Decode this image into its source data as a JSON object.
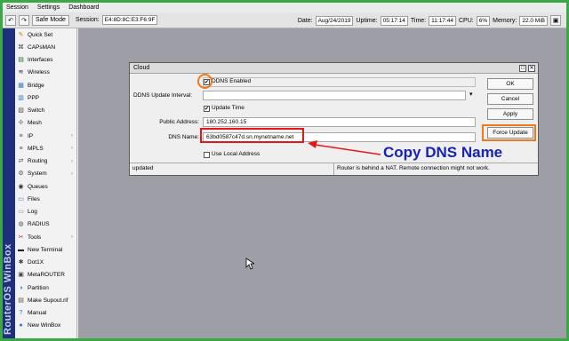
{
  "menubar": [
    "Session",
    "Settings",
    "Dashboard"
  ],
  "toolbar": {
    "safe_mode": "Safe Mode",
    "session_label": "Session:",
    "session_value": "E4:8D:8C:E3:F6:9F",
    "date_label": "Date:",
    "date_value": "Aug/24/2019",
    "uptime_label": "Uptime:",
    "uptime_value": "05:17:14",
    "time_label": "Time:",
    "time_value": "11:17:44",
    "cpu_label": "CPU:",
    "cpu_value": "6%",
    "memory_label": "Memory:",
    "memory_value": "22.0 MiB"
  },
  "banner": "RouterOS WinBox",
  "sidebar": [
    {
      "label": "Quick Set",
      "icon": "quick-set-icon",
      "glyph": "✎",
      "color": "#b8860b",
      "sub": false
    },
    {
      "label": "CAPsMAN",
      "icon": "capsman-icon",
      "glyph": "⌘",
      "color": "#444",
      "sub": false
    },
    {
      "label": "Interfaces",
      "icon": "interfaces-icon",
      "glyph": "▤",
      "color": "#2a6a2a",
      "sub": false
    },
    {
      "label": "Wireless",
      "icon": "wireless-icon",
      "glyph": "≋",
      "color": "#333",
      "sub": false
    },
    {
      "label": "Bridge",
      "icon": "bridge-icon",
      "glyph": "▦",
      "color": "#2d7ab8",
      "sub": false
    },
    {
      "label": "PPP",
      "icon": "ppp-icon",
      "glyph": "▥",
      "color": "#2d7ab8",
      "sub": false
    },
    {
      "label": "Switch",
      "icon": "switch-icon",
      "glyph": "▧",
      "color": "#555",
      "sub": false
    },
    {
      "label": "Mesh",
      "icon": "mesh-icon",
      "glyph": "✣",
      "color": "#777",
      "sub": false
    },
    {
      "label": "IP",
      "icon": "ip-icon",
      "glyph": "≡",
      "color": "#555",
      "sub": true
    },
    {
      "label": "MPLS",
      "icon": "mpls-icon",
      "glyph": "≡",
      "color": "#555",
      "sub": true
    },
    {
      "label": "Routing",
      "icon": "routing-icon",
      "glyph": "⇄",
      "color": "#555",
      "sub": true
    },
    {
      "label": "System",
      "icon": "system-icon",
      "glyph": "⚙",
      "color": "#555",
      "sub": true
    },
    {
      "label": "Queues",
      "icon": "queues-icon",
      "glyph": "◉",
      "color": "#333",
      "sub": false
    },
    {
      "label": "Files",
      "icon": "files-icon",
      "glyph": "▭",
      "color": "#2d7ab8",
      "sub": false
    },
    {
      "label": "Log",
      "icon": "log-icon",
      "glyph": "▭",
      "color": "#888",
      "sub": false
    },
    {
      "label": "RADIUS",
      "icon": "radius-icon",
      "glyph": "◍",
      "color": "#555",
      "sub": false
    },
    {
      "label": "Tools",
      "icon": "tools-icon",
      "glyph": "✂",
      "color": "#a33",
      "sub": true
    },
    {
      "label": "New Terminal",
      "icon": "terminal-icon",
      "glyph": "▬",
      "color": "#222",
      "sub": false
    },
    {
      "label": "Dot1X",
      "icon": "dot1x-icon",
      "glyph": "✱",
      "color": "#444",
      "sub": false
    },
    {
      "label": "MetaROUTER",
      "icon": "metarouter-icon",
      "glyph": "▣",
      "color": "#444",
      "sub": false
    },
    {
      "label": "Partition",
      "icon": "partition-icon",
      "glyph": "◑",
      "color": "#2d7ab8",
      "sub": false
    },
    {
      "label": "Make Supout.rif",
      "icon": "supout-icon",
      "glyph": "▤",
      "color": "#555",
      "sub": false
    },
    {
      "label": "Manual",
      "icon": "manual-icon",
      "glyph": "?",
      "color": "#2d7ab8",
      "sub": false
    },
    {
      "label": "New WinBox",
      "icon": "winbox-icon",
      "glyph": "●",
      "color": "#2d7ab8",
      "sub": false
    }
  ],
  "dialog": {
    "title": "Cloud",
    "ddns_enabled_label": "DDNS Enabled",
    "ddns_enabled": true,
    "update_interval_label": "DDNS Update Interval:",
    "update_interval_value": "",
    "update_time_label": "Update Time",
    "update_time": true,
    "public_address_label": "Public Address:",
    "public_address_value": "180.252.160.15",
    "dns_name_label": "DNS Name:",
    "dns_name_value": "63bd0587c47d.sn.mynetname.net",
    "use_local_address_label": "Use Local Address",
    "use_local_address": false,
    "buttons": {
      "ok": "OK",
      "cancel": "Cancel",
      "apply": "Apply",
      "force_update": "Force Update"
    },
    "status_left": "updated",
    "status_right": "Router is behind a NAT. Remote connection might not work."
  },
  "annotation_text": "Copy DNS Name",
  "colors": {
    "highlight_orange": "#ee7a1d",
    "highlight_red": "#e4171b",
    "annotation_blue": "#1722b8",
    "frame_green": "#39a845"
  }
}
